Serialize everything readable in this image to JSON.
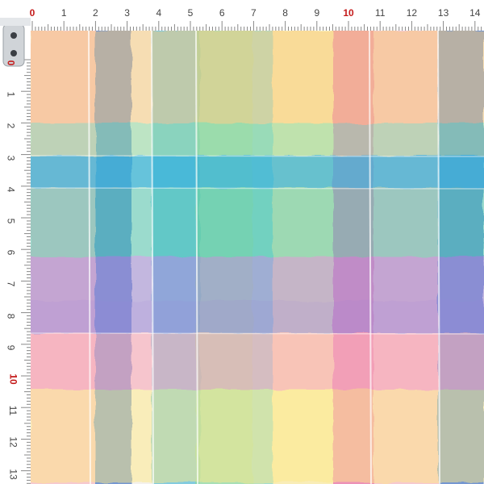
{
  "rulers": {
    "top_labels": [
      "0",
      "1",
      "2",
      "3",
      "4",
      "5",
      "6",
      "7",
      "8",
      "9",
      "10",
      "11",
      "12",
      "13",
      "14"
    ],
    "left_labels": [
      "0",
      "1",
      "2",
      "3",
      "4",
      "5",
      "6",
      "7",
      "8",
      "9",
      "10",
      "11",
      "12",
      "13"
    ],
    "highlight_color": "#c41a1a",
    "tick_color": "#888888"
  },
  "fabric": {
    "pattern": "watercolor plaid",
    "palette": [
      "#f7a8b8",
      "#f9c97a",
      "#fde98a",
      "#8fd8a4",
      "#3fc6b0",
      "#36b3d6",
      "#4a78c8",
      "#9b86d6",
      "#e86aa0"
    ]
  }
}
